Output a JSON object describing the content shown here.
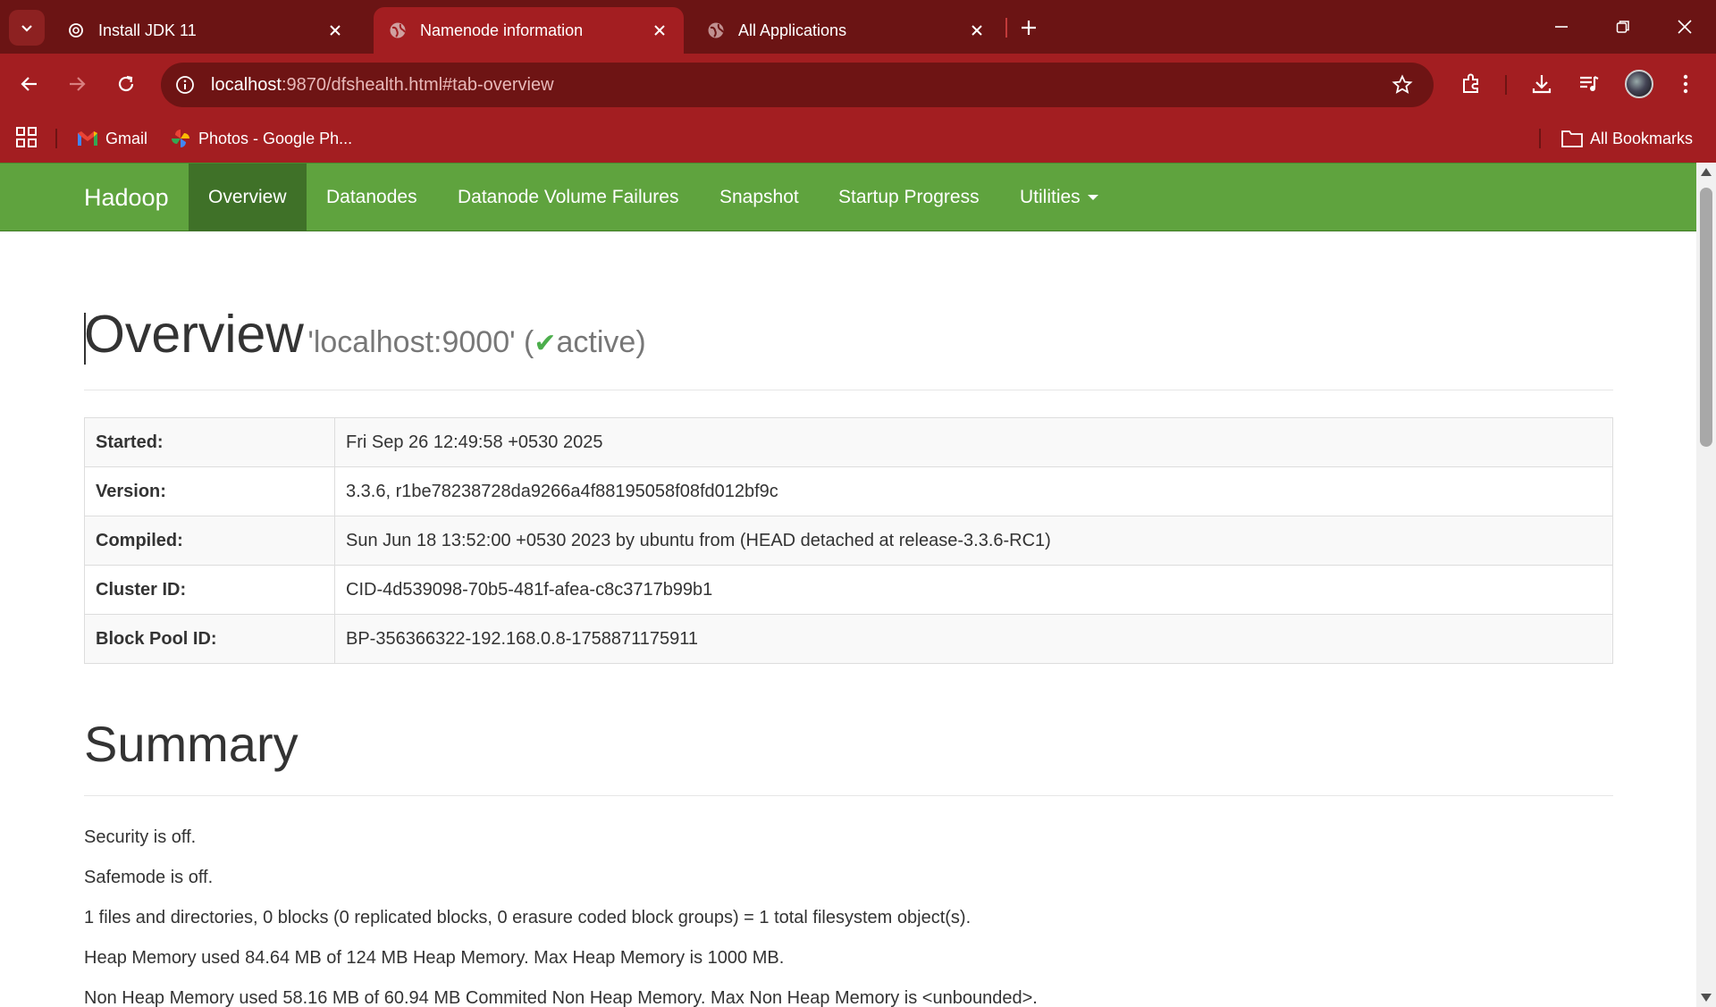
{
  "browser": {
    "tabs": [
      {
        "title": "Install JDK 11",
        "icon": "openai-icon"
      },
      {
        "title": "Namenode information",
        "icon": "globe-icon",
        "active": true
      },
      {
        "title": "All Applications",
        "icon": "globe-icon"
      }
    ],
    "url_host": "localhost",
    "url_rest": ":9870/dfshealth.html#tab-overview",
    "bookmarks": [
      {
        "label": "Gmail",
        "icon": "gmail-icon"
      },
      {
        "label": "Photos - Google Ph...",
        "icon": "google-photos-icon"
      }
    ],
    "all_bookmarks_label": "All Bookmarks"
  },
  "navbar": {
    "brand": "Hadoop",
    "items": [
      "Overview",
      "Datanodes",
      "Datanode Volume Failures",
      "Snapshot",
      "Startup Progress",
      "Utilities"
    ],
    "active_item": "Overview"
  },
  "overview": {
    "title": "Overview",
    "host": "'localhost:9000' (",
    "check": "✔",
    "state": "active)",
    "rows": [
      {
        "key": "Started:",
        "value": "Fri Sep 26 12:49:58 +0530 2025"
      },
      {
        "key": "Version:",
        "value": "3.3.6, r1be78238728da9266a4f88195058f08fd012bf9c"
      },
      {
        "key": "Compiled:",
        "value": "Sun Jun 18 13:52:00 +0530 2023 by ubuntu from (HEAD detached at release-3.3.6-RC1)"
      },
      {
        "key": "Cluster ID:",
        "value": "CID-4d539098-70b5-481f-afea-c8c3717b99b1"
      },
      {
        "key": "Block Pool ID:",
        "value": "BP-356366322-192.168.0.8-1758871175911"
      }
    ]
  },
  "summary": {
    "title": "Summary",
    "lines": [
      "Security is off.",
      "Safemode is off.",
      "1 files and directories, 0 blocks (0 replicated blocks, 0 erasure coded block groups) = 1 total filesystem object(s).",
      "Heap Memory used 84.64 MB of 124 MB Heap Memory. Max Heap Memory is 1000 MB.",
      "Non Heap Memory used 58.16 MB of 60.94 MB Commited Non Heap Memory. Max Non Heap Memory is <unbounded>."
    ]
  },
  "colors": {
    "tabstrip": "#6b1414",
    "toolbar": "#a31e21",
    "navbar": "#5fa33e",
    "navbar_active": "#3f7128",
    "active_check": "#4cae4c"
  }
}
